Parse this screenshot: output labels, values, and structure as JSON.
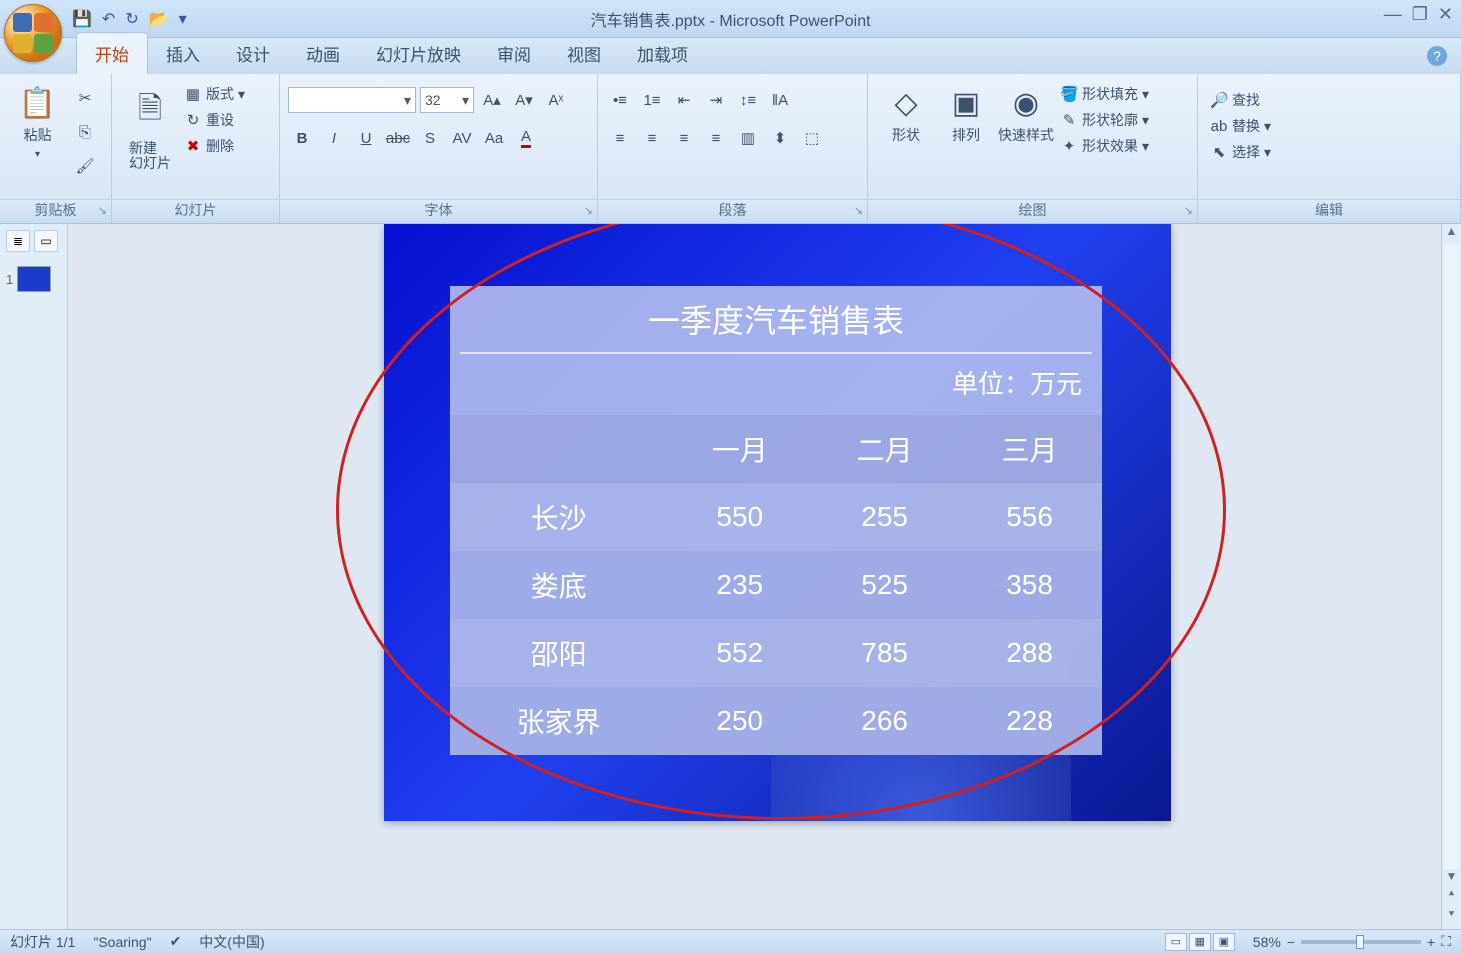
{
  "title": {
    "filename": "汽车销售表.pptx",
    "app": "Microsoft PowerPoint"
  },
  "qat": {
    "save": "💾",
    "undo": "↶",
    "redo": "↻",
    "open": "📂"
  },
  "tabs": {
    "home": "开始",
    "insert": "插入",
    "design": "设计",
    "anim": "动画",
    "slideshow": "幻灯片放映",
    "review": "审阅",
    "view": "视图",
    "addin": "加载项"
  },
  "ribbon": {
    "clipboard": {
      "paste": "粘贴",
      "label": "剪贴板"
    },
    "slides": {
      "new": "新建\n幻灯片",
      "layout": "版式",
      "reset": "重设",
      "delete": "删除",
      "label": "幻灯片"
    },
    "font": {
      "size": "32",
      "label": "字体"
    },
    "para": {
      "label": "段落"
    },
    "draw": {
      "shapes": "形状",
      "arrange": "排列",
      "quick": "快速样式",
      "fill": "形状填充",
      "outline": "形状轮廓",
      "effect": "形状效果",
      "label": "绘图"
    },
    "edit": {
      "find": "查找",
      "replace": "替换",
      "select": "选择",
      "label": "编辑"
    }
  },
  "slide": {
    "title": "一季度汽车销售表",
    "unit": "单位：万元",
    "headers": [
      "",
      "一月",
      "二月",
      "三月"
    ],
    "rows": [
      {
        "city": "长沙",
        "v": [
          "550",
          "255",
          "556"
        ]
      },
      {
        "city": "娄底",
        "v": [
          "235",
          "525",
          "358"
        ]
      },
      {
        "city": "邵阳",
        "v": [
          "552",
          "785",
          "288"
        ]
      },
      {
        "city": "张家界",
        "v": [
          "250",
          "266",
          "228"
        ]
      }
    ]
  },
  "status": {
    "slide_no": "幻灯片 1/1",
    "theme": "\"Soaring\"",
    "lang": "中文(中国)",
    "zoom": "58%"
  },
  "chart_data": {
    "type": "table",
    "title": "一季度汽车销售表",
    "unit": "万元",
    "categories": [
      "一月",
      "二月",
      "三月"
    ],
    "series": [
      {
        "name": "长沙",
        "values": [
          550,
          255,
          556
        ]
      },
      {
        "name": "娄底",
        "values": [
          235,
          525,
          358
        ]
      },
      {
        "name": "邵阳",
        "values": [
          552,
          785,
          288
        ]
      },
      {
        "name": "张家界",
        "values": [
          250,
          266,
          228
        ]
      }
    ]
  }
}
